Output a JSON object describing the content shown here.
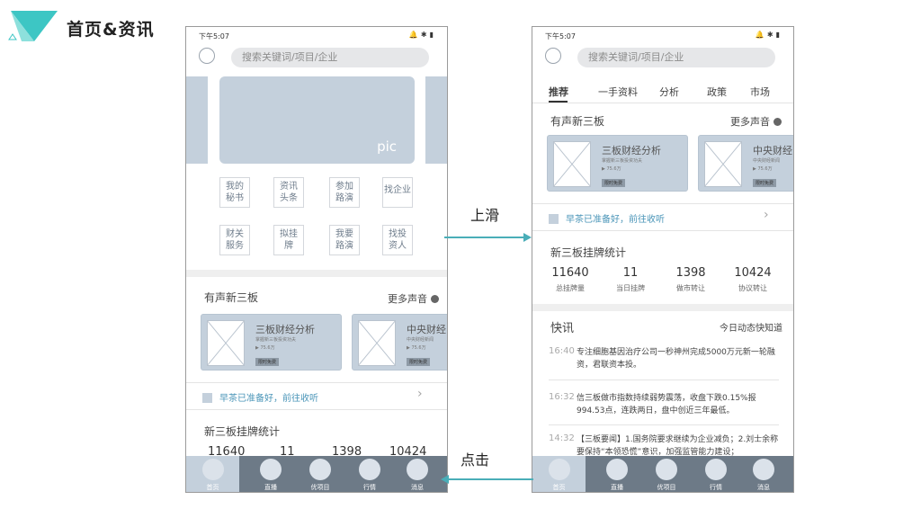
{
  "page": {
    "heading": "首页&资讯",
    "colors": {
      "accent": "#4aaeb8",
      "card": "#c4d0dc",
      "nav": "#6d7a87",
      "logo": "#3dc6c4"
    }
  },
  "left_screen": {
    "status_time": "下午5:07",
    "search_placeholder": "搜索关键词/项目/企业",
    "banner_label": "pic",
    "grid": [
      "我的\n秘书",
      "资讯\n头条",
      "参加\n路演",
      "找企业",
      "财关\n服务",
      "拟挂\n牌",
      "我要\n路演",
      "找投\n资人"
    ],
    "voice_section": {
      "title": "有声新三板",
      "more": "更多声音"
    },
    "cards": [
      {
        "title": "三板财经分析",
        "sub": "掌握新三板投资功夫",
        "plays": "75.6万",
        "badge": "限时免费"
      },
      {
        "title": "中央财经",
        "sub": "中央财经新闻",
        "plays": "75.6万",
        "badge": "限时免费"
      }
    ],
    "breakfast": "早茶已准备好，前往收听",
    "stats_title": "新三板挂牌统计",
    "stats_partial": [
      "11640",
      "11",
      "1398",
      "10424"
    ],
    "nav": [
      "首页",
      "直播",
      "优项目",
      "行情",
      "消息"
    ]
  },
  "right_screen": {
    "status_time": "下午5:07",
    "search_placeholder": "搜索关键词/项目/企业",
    "tabs": [
      "推荐",
      "一手资料",
      "分析",
      "政策",
      "市场"
    ],
    "voice_section": {
      "title": "有声新三板",
      "more": "更多声音"
    },
    "cards": [
      {
        "title": "三板财经分析",
        "sub": "掌握新三板投资功夫",
        "plays": "75.6万",
        "badge": "限时免费"
      },
      {
        "title": "中央财经",
        "sub": "中央财经新闻",
        "plays": "75.6万",
        "badge": "限时免费"
      }
    ],
    "breakfast": "早茶已准备好，前往收听",
    "stats_title": "新三板挂牌统计",
    "stats": [
      {
        "num": "11640",
        "label": "总挂牌量"
      },
      {
        "num": "11",
        "label": "当日挂牌"
      },
      {
        "num": "1398",
        "label": "做市转让"
      },
      {
        "num": "10424",
        "label": "协议转让"
      }
    ],
    "news_title": "快讯",
    "news_more": "今日动态快知道",
    "news": [
      {
        "time": "16:40",
        "text": "专注细胞基因治疗公司一秒神州完成5000万元新一轮融资，君联资本投。"
      },
      {
        "time": "16:32",
        "text": "信三板做市指数持续弱势震荡，收盘下跌0.15%报994.53点，连跌两日，盘中创近三年最低。"
      },
      {
        "time": "14:32",
        "text": "【三板要闻】1.国务院要求继续为企业减负；2.刘士余称要保持“本领恐慌”意识，加强监管能力建设；"
      }
    ],
    "nav": [
      "首页",
      "直播",
      "优项目",
      "行情",
      "消息"
    ]
  },
  "annotations": {
    "swipe_up": "上滑",
    "click": "点击"
  }
}
